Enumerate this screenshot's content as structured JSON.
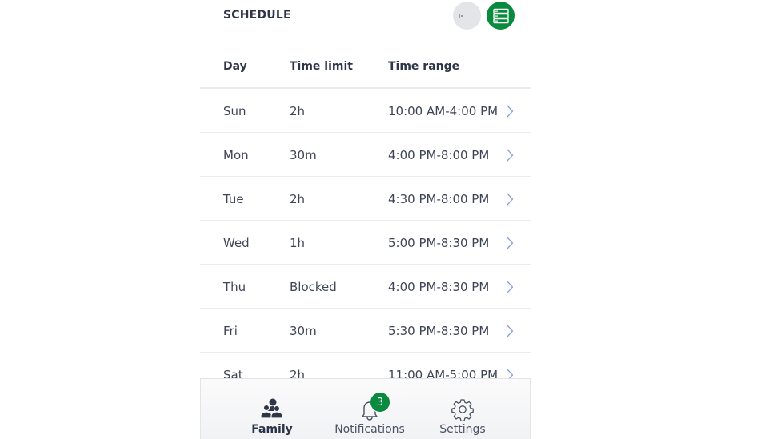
{
  "schedule": {
    "title": "SCHEDULE",
    "view_toggle": {
      "compact_icon": "compact-view-icon",
      "expanded_icon": "expanded-list-icon",
      "active": "expanded",
      "accent_color": "#0a8a3f"
    },
    "columns": [
      "Day",
      "Time limit",
      "Time range"
    ],
    "rows": [
      {
        "day": "Sun",
        "limit": "2h",
        "range": "10:00 AM-4:00 PM"
      },
      {
        "day": "Mon",
        "limit": "30m",
        "range": "4:00 PM-8:00 PM"
      },
      {
        "day": "Tue",
        "limit": "2h",
        "range": "4:30 PM-8:00 PM"
      },
      {
        "day": "Wed",
        "limit": "1h",
        "range": "5:00 PM-8:30 PM"
      },
      {
        "day": "Thu",
        "limit": "Blocked",
        "range": "4:00 PM-8:30 PM"
      },
      {
        "day": "Fri",
        "limit": "30m",
        "range": "5:30 PM-8:30 PM"
      },
      {
        "day": "Sat",
        "limit": "2h",
        "range": "11:00 AM-5:00 PM"
      }
    ]
  },
  "nav": {
    "items": [
      {
        "label": "Family",
        "icon": "family-icon",
        "active": true
      },
      {
        "label": "Notifications",
        "icon": "bell-icon",
        "badge": "3"
      },
      {
        "label": "Settings",
        "icon": "gear-icon"
      }
    ]
  }
}
